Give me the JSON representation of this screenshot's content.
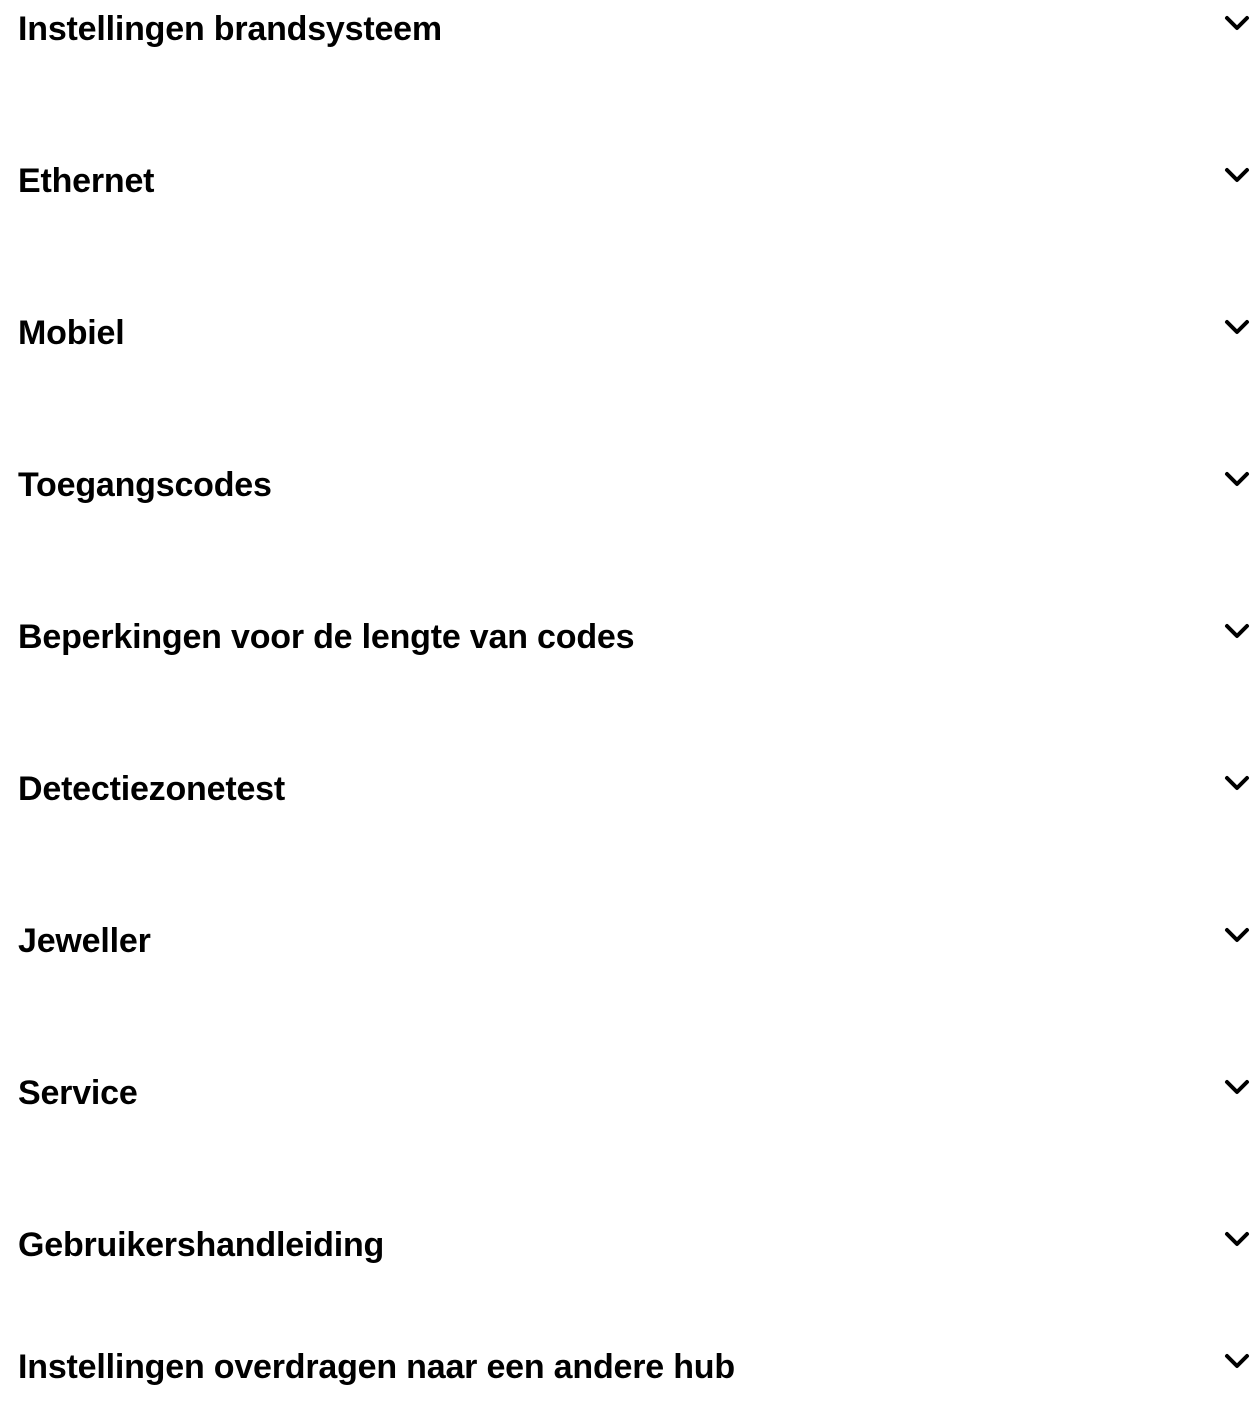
{
  "accordion": {
    "items": [
      {
        "label": "Instellingen brandsysteem",
        "icon": "chevron-down-icon",
        "expanded": false
      },
      {
        "label": "Ethernet",
        "icon": "chevron-down-icon",
        "expanded": false
      },
      {
        "label": "Mobiel",
        "icon": "chevron-down-icon",
        "expanded": false
      },
      {
        "label": "Toegangscodes",
        "icon": "chevron-down-icon",
        "expanded": false
      },
      {
        "label": "Beperkingen voor de lengte van codes",
        "icon": "chevron-down-icon",
        "expanded": false
      },
      {
        "label": "Detectiezonetest",
        "icon": "chevron-down-icon",
        "expanded": false
      },
      {
        "label": "Jeweller",
        "icon": "chevron-down-icon",
        "expanded": false
      },
      {
        "label": "Service",
        "icon": "chevron-down-icon",
        "expanded": false
      },
      {
        "label": "Gebruikershandleiding",
        "icon": "chevron-down-icon",
        "expanded": false
      },
      {
        "label": "Instellingen overdragen naar een andere hub",
        "icon": "chevron-down-icon",
        "expanded": false
      }
    ]
  },
  "colors": {
    "text": "#000000",
    "background": "#ffffff"
  }
}
